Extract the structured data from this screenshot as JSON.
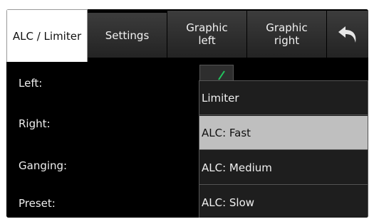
{
  "tabs": [
    {
      "label": "ALC / Limiter",
      "active": true
    },
    {
      "label": "Settings",
      "active": false
    },
    {
      "label": "Graphic\nleft",
      "active": false
    },
    {
      "label": "Graphic\nright",
      "active": false
    }
  ],
  "back_icon": "undo-arrow-icon",
  "form": {
    "left_label": "Left:",
    "right_label": "Right:",
    "ganging_label": "Ganging:",
    "preset_label": "Preset:"
  },
  "dropdown": {
    "options": [
      "Limiter",
      "ALC: Fast",
      "ALC: Medium",
      "ALC: Slow"
    ],
    "selected": "ALC: Fast"
  },
  "colors": {
    "accent": "#22c55e",
    "selected_row": "#bfbfbf"
  }
}
